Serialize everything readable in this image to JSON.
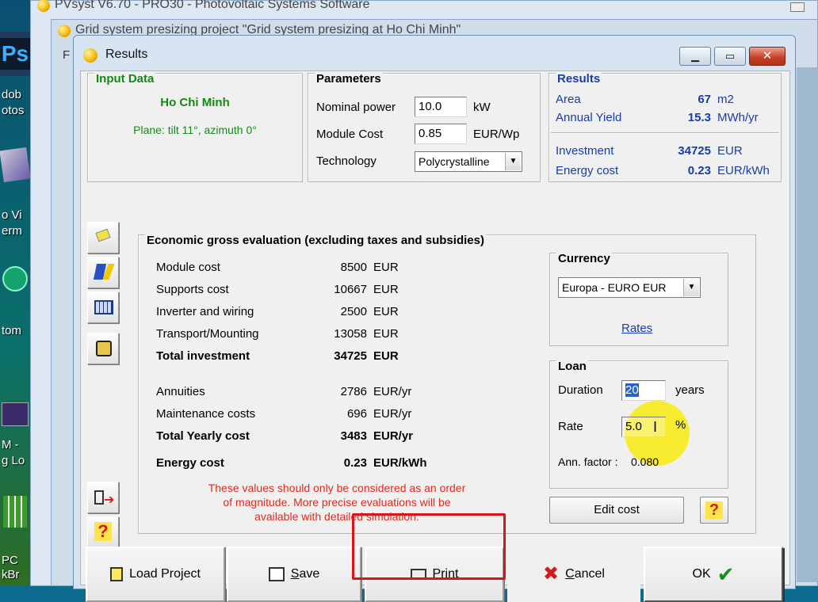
{
  "desktop": {
    "labels": [
      "dob",
      "otos",
      "o Vi",
      "erm",
      "tom",
      "M -",
      "g Lo",
      "PC",
      "kBr"
    ]
  },
  "bg_windows": {
    "pvsyst_title": "PVsyst V6.70 - PRO30 - Photovoltaic Systems Software",
    "presizing_title": "Grid system presizing project  \"Grid system presizing  at  Ho Chi Minh\"",
    "menu_letter": "F"
  },
  "window": {
    "title": "Results",
    "minimize_glyph": "▁",
    "maximize_glyph": "▭",
    "close_glyph": "✕"
  },
  "input_data": {
    "title": "Input Data",
    "site": "Ho Chi Minh",
    "plane": "Plane: tilt 11°, azimuth 0°"
  },
  "parameters": {
    "title": "Parameters",
    "nominal_power_label": "Nominal power",
    "nominal_power_value": "10.0",
    "nominal_power_unit": "kW",
    "module_cost_label": "Module Cost",
    "module_cost_value": "0.85",
    "module_cost_unit": "EUR/Wp",
    "technology_label": "Technology",
    "technology_value": "Polycrystalline"
  },
  "results": {
    "title": "Results",
    "area_label": "Area",
    "area_value": "67",
    "area_unit": "m2",
    "yield_label": "Annual Yield",
    "yield_value": "15.3",
    "yield_unit": "MWh/yr",
    "investment_label": "Investment",
    "investment_value": "34725",
    "investment_unit": "EUR",
    "energy_cost_label": "Energy cost",
    "energy_cost_value": "0.23",
    "energy_cost_unit": "EUR/kWh"
  },
  "economic": {
    "title": "Economic gross evaluation   (excluding taxes and subsidies)",
    "rows": [
      {
        "label": "Module cost",
        "value": "8500",
        "unit": "EUR",
        "bold": false
      },
      {
        "label": "Supports cost",
        "value": "10667",
        "unit": "EUR",
        "bold": false
      },
      {
        "label": "Inverter and wiring",
        "value": "2500",
        "unit": "EUR",
        "bold": false
      },
      {
        "label": "Transport/Mounting",
        "value": "13058",
        "unit": "EUR",
        "bold": false
      },
      {
        "label": "Total investment",
        "value": "34725",
        "unit": "EUR",
        "bold": true
      },
      {
        "label": "Annuities",
        "value": "2786",
        "unit": "EUR/yr",
        "bold": false
      },
      {
        "label": "Maintenance costs",
        "value": "696",
        "unit": "EUR/yr",
        "bold": false
      },
      {
        "label": "Total Yearly cost",
        "value": "3483",
        "unit": "EUR/yr",
        "bold": true
      },
      {
        "label": "Energy cost",
        "value": "0.23",
        "unit": "EUR/kWh",
        "bold": true
      }
    ],
    "note_line1": "These values should only be considered as an order",
    "note_line2": "of magnitude. More precise evaluations will be",
    "note_line3": "available with detailed simulation."
  },
  "currency": {
    "title": "Currency",
    "value": "Europa - EURO   EUR",
    "rates_link": "Rates"
  },
  "loan": {
    "title": "Loan",
    "duration_label": "Duration",
    "duration_value": "20",
    "duration_unit": "years",
    "rate_label": "Rate",
    "rate_value": "5.0",
    "rate_unit": "%",
    "ann_factor_label": "Ann. factor :",
    "ann_factor_value": "0.080"
  },
  "buttons": {
    "edit_cost": "Edit cost",
    "help": "?",
    "load_project": "Load Project",
    "save_first": "S",
    "save_rest": "ave",
    "print_first": "P",
    "print_rest": "rint",
    "cancel_first": "C",
    "cancel_rest": "ancel",
    "ok": "OK"
  },
  "colors": {
    "accent_green": "#128a12",
    "accent_blue": "#1a3ca8",
    "warning_red": "#e02a1c",
    "highlight_ring": "#d9151b"
  }
}
